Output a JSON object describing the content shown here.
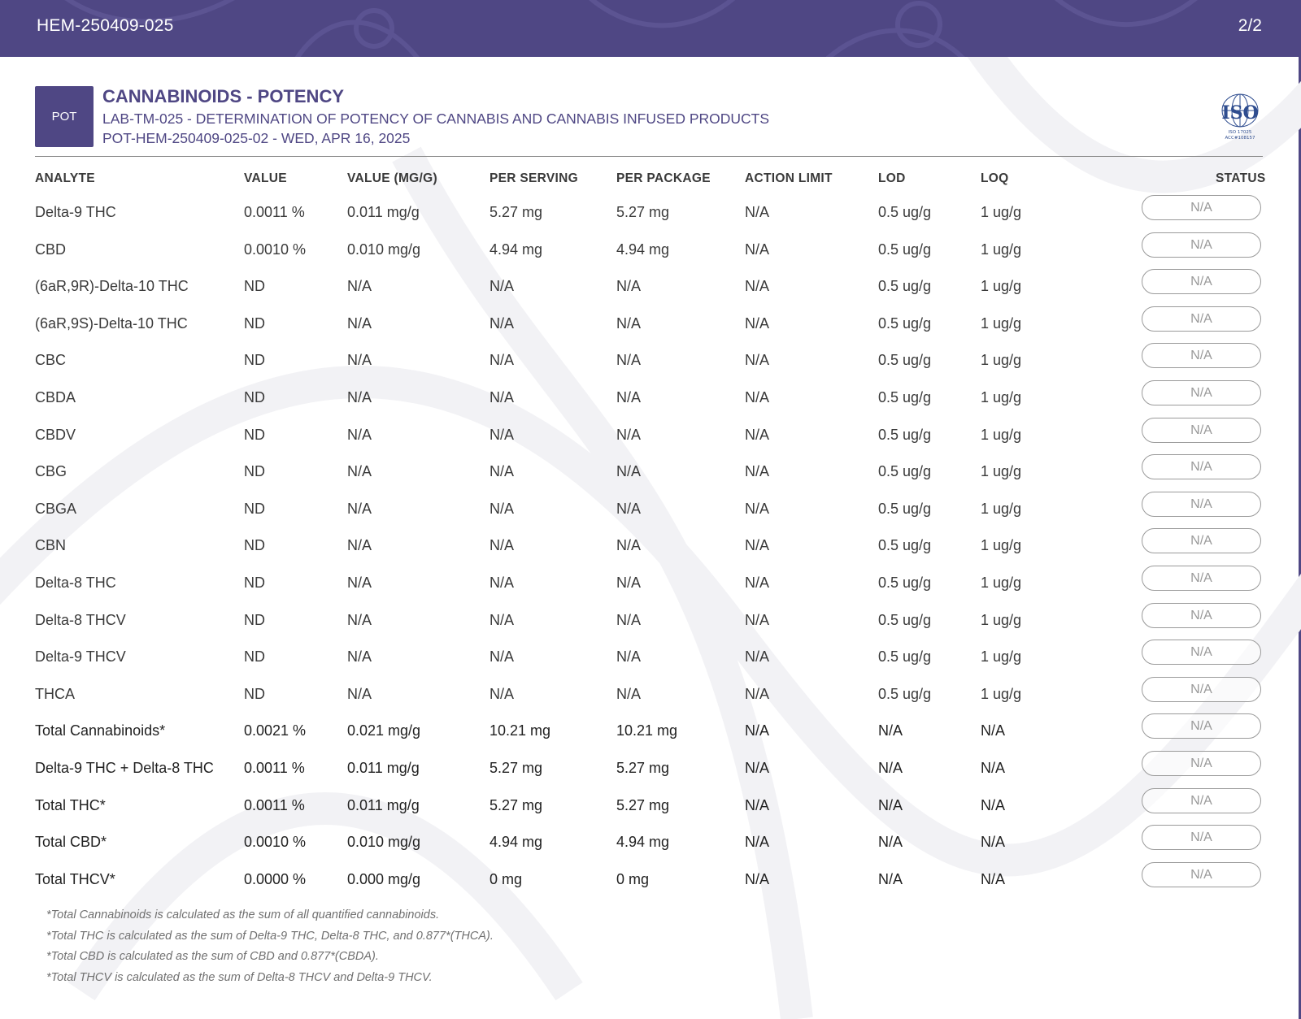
{
  "header": {
    "doc_id": "HEM-250409-025",
    "page": "2/2"
  },
  "section": {
    "badge": "POT",
    "title": "CANNABINOIDS - POTENCY",
    "method": "LAB-TM-025 - DETERMINATION OF POTENCY OF CANNABIS AND CANNABIS INFUSED PRODUCTS",
    "sample": "POT-HEM-250409-025-02 - WED, APR 16, 2025",
    "iso_logo": {
      "mark": "ISO",
      "line1": "ISO 17025",
      "line2": "ACC#108157"
    }
  },
  "columns": [
    "ANALYTE",
    "VALUE",
    "VALUE (MG/G)",
    "PER SERVING",
    "PER PACKAGE",
    "ACTION LIMIT",
    "LOD",
    "LOQ",
    "STATUS"
  ],
  "rows": [
    {
      "analyte": "Delta-9 THC",
      "value": "0.0011 %",
      "mg_g": "0.011 mg/g",
      "per_serving": "5.27 mg",
      "per_package": "5.27 mg",
      "action_limit": "N/A",
      "lod": "0.5 ug/g",
      "loq": "1 ug/g",
      "status": "N/A",
      "total": false
    },
    {
      "analyte": "CBD",
      "value": "0.0010 %",
      "mg_g": "0.010 mg/g",
      "per_serving": "4.94 mg",
      "per_package": "4.94 mg",
      "action_limit": "N/A",
      "lod": "0.5 ug/g",
      "loq": "1 ug/g",
      "status": "N/A",
      "total": false
    },
    {
      "analyte": "(6aR,9R)-Delta-10 THC",
      "value": "ND",
      "mg_g": "N/A",
      "per_serving": "N/A",
      "per_package": "N/A",
      "action_limit": "N/A",
      "lod": "0.5 ug/g",
      "loq": "1 ug/g",
      "status": "N/A",
      "total": false
    },
    {
      "analyte": "(6aR,9S)-Delta-10 THC",
      "value": "ND",
      "mg_g": "N/A",
      "per_serving": "N/A",
      "per_package": "N/A",
      "action_limit": "N/A",
      "lod": "0.5 ug/g",
      "loq": "1 ug/g",
      "status": "N/A",
      "total": false
    },
    {
      "analyte": "CBC",
      "value": "ND",
      "mg_g": "N/A",
      "per_serving": "N/A",
      "per_package": "N/A",
      "action_limit": "N/A",
      "lod": "0.5 ug/g",
      "loq": "1 ug/g",
      "status": "N/A",
      "total": false
    },
    {
      "analyte": "CBDA",
      "value": "ND",
      "mg_g": "N/A",
      "per_serving": "N/A",
      "per_package": "N/A",
      "action_limit": "N/A",
      "lod": "0.5 ug/g",
      "loq": "1 ug/g",
      "status": "N/A",
      "total": false
    },
    {
      "analyte": "CBDV",
      "value": "ND",
      "mg_g": "N/A",
      "per_serving": "N/A",
      "per_package": "N/A",
      "action_limit": "N/A",
      "lod": "0.5 ug/g",
      "loq": "1 ug/g",
      "status": "N/A",
      "total": false
    },
    {
      "analyte": "CBG",
      "value": "ND",
      "mg_g": "N/A",
      "per_serving": "N/A",
      "per_package": "N/A",
      "action_limit": "N/A",
      "lod": "0.5 ug/g",
      "loq": "1 ug/g",
      "status": "N/A",
      "total": false
    },
    {
      "analyte": "CBGA",
      "value": "ND",
      "mg_g": "N/A",
      "per_serving": "N/A",
      "per_package": "N/A",
      "action_limit": "N/A",
      "lod": "0.5 ug/g",
      "loq": "1 ug/g",
      "status": "N/A",
      "total": false
    },
    {
      "analyte": "CBN",
      "value": "ND",
      "mg_g": "N/A",
      "per_serving": "N/A",
      "per_package": "N/A",
      "action_limit": "N/A",
      "lod": "0.5 ug/g",
      "loq": "1 ug/g",
      "status": "N/A",
      "total": false
    },
    {
      "analyte": "Delta-8 THC",
      "value": "ND",
      "mg_g": "N/A",
      "per_serving": "N/A",
      "per_package": "N/A",
      "action_limit": "N/A",
      "lod": "0.5 ug/g",
      "loq": "1 ug/g",
      "status": "N/A",
      "total": false
    },
    {
      "analyte": "Delta-8 THCV",
      "value": "ND",
      "mg_g": "N/A",
      "per_serving": "N/A",
      "per_package": "N/A",
      "action_limit": "N/A",
      "lod": "0.5 ug/g",
      "loq": "1 ug/g",
      "status": "N/A",
      "total": false
    },
    {
      "analyte": "Delta-9 THCV",
      "value": "ND",
      "mg_g": "N/A",
      "per_serving": "N/A",
      "per_package": "N/A",
      "action_limit": "N/A",
      "lod": "0.5 ug/g",
      "loq": "1 ug/g",
      "status": "N/A",
      "total": false
    },
    {
      "analyte": "THCA",
      "value": "ND",
      "mg_g": "N/A",
      "per_serving": "N/A",
      "per_package": "N/A",
      "action_limit": "N/A",
      "lod": "0.5 ug/g",
      "loq": "1 ug/g",
      "status": "N/A",
      "total": false
    },
    {
      "analyte": "Total Cannabinoids*",
      "value": "0.0021 %",
      "mg_g": "0.021 mg/g",
      "per_serving": "10.21 mg",
      "per_package": "10.21 mg",
      "action_limit": "N/A",
      "lod": "N/A",
      "loq": "N/A",
      "status": "N/A",
      "total": true
    },
    {
      "analyte": "Delta-9 THC + Delta-8 THC",
      "value": "0.0011 %",
      "mg_g": "0.011 mg/g",
      "per_serving": "5.27 mg",
      "per_package": "5.27 mg",
      "action_limit": "N/A",
      "lod": "N/A",
      "loq": "N/A",
      "status": "N/A",
      "total": true
    },
    {
      "analyte": "Total THC*",
      "value": "0.0011 %",
      "mg_g": "0.011 mg/g",
      "per_serving": "5.27 mg",
      "per_package": "5.27 mg",
      "action_limit": "N/A",
      "lod": "N/A",
      "loq": "N/A",
      "status": "N/A",
      "total": true
    },
    {
      "analyte": "Total CBD*",
      "value": "0.0010 %",
      "mg_g": "0.010 mg/g",
      "per_serving": "4.94 mg",
      "per_package": "4.94 mg",
      "action_limit": "N/A",
      "lod": "N/A",
      "loq": "N/A",
      "status": "N/A",
      "total": true
    },
    {
      "analyte": "Total THCV*",
      "value": "0.0000 %",
      "mg_g": "0.000 mg/g",
      "per_serving": "0 mg",
      "per_package": "0 mg",
      "action_limit": "N/A",
      "lod": "N/A",
      "loq": "N/A",
      "status": "N/A",
      "total": true
    }
  ],
  "notes": [
    "*Total Cannabinoids is calculated as the sum of all quantified cannabinoids.",
    "*Total THC is calculated as the sum of Delta-9 THC, Delta-8 THC, and 0.877*(THCA).",
    "*Total CBD is calculated as the sum of CBD and 0.877*(CBDA).",
    "*Total THCV is calculated as the sum of Delta-8 THCV and Delta-9 THCV."
  ],
  "colors": {
    "brand": "#4f4784",
    "pill_border": "#9a9a9a",
    "text": "#3a3a3a"
  }
}
